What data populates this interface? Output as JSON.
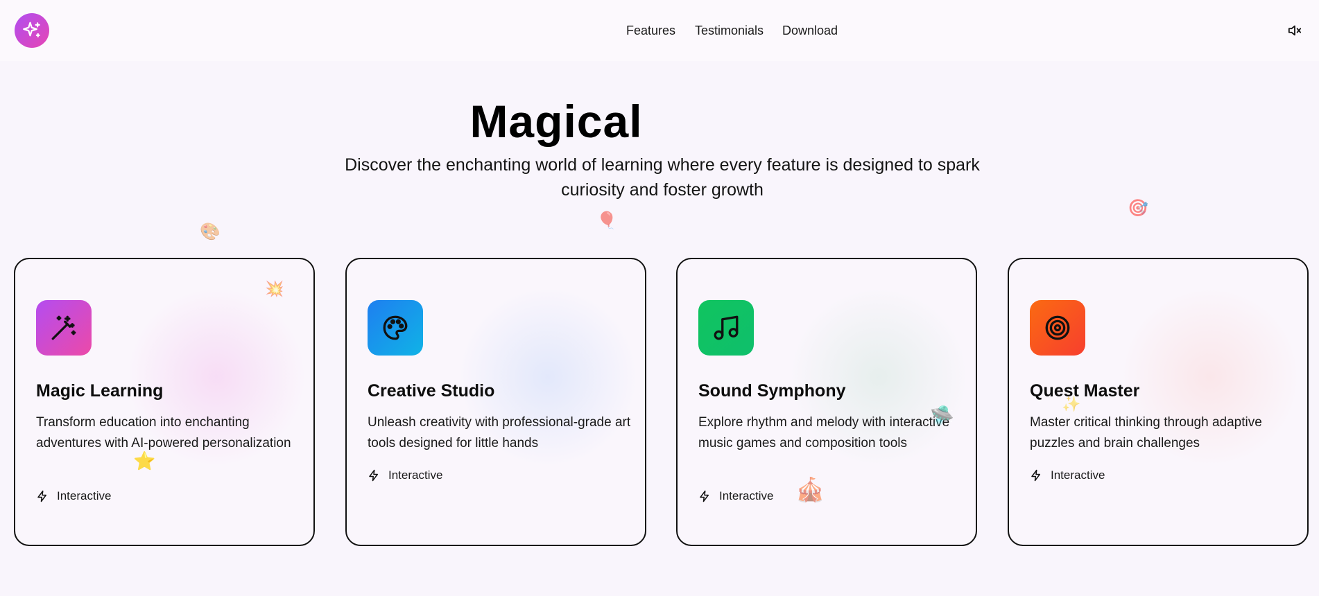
{
  "nav": {
    "items": [
      "Features",
      "Testimonials",
      "Download"
    ]
  },
  "hero": {
    "title": "Magical",
    "subtitle": "Discover the enchanting world of learning where every feature is designed to spark curiosity and foster growth"
  },
  "decorations": [
    "🎨",
    "🎈",
    "🎯",
    "💥",
    "⭐",
    "🛸",
    "🎪",
    "✨"
  ],
  "cards": [
    {
      "title": "Magic Learning",
      "description": "Transform education into enchanting adventures with AI-powered personalization",
      "tag": "Interactive",
      "icon": "magic-wand-icon",
      "color_from": "#b44cf0",
      "color_to": "#ec4aa8"
    },
    {
      "title": "Creative Studio",
      "description": "Unleash creativity with professional-grade art tools designed for little hands",
      "tag": "Interactive",
      "icon": "palette-icon",
      "color_from": "#1e7ff0",
      "color_to": "#10b3e6"
    },
    {
      "title": "Sound Symphony",
      "description": "Explore rhythm and melody with interactive music games and composition tools",
      "tag": "Interactive",
      "icon": "music-note-icon",
      "color_from": "#10c45f",
      "color_to": "#0fbf6c"
    },
    {
      "title": "Quest Master",
      "description": "Master critical thinking through adaptive puzzles and brain challenges",
      "tag": "Interactive",
      "icon": "target-icon",
      "color_from": "#fb6a12",
      "color_to": "#f73f2e"
    }
  ],
  "colors": {
    "background": "#f9f5fc",
    "logo_from": "#b04ef0",
    "logo_to": "#e645b4"
  }
}
